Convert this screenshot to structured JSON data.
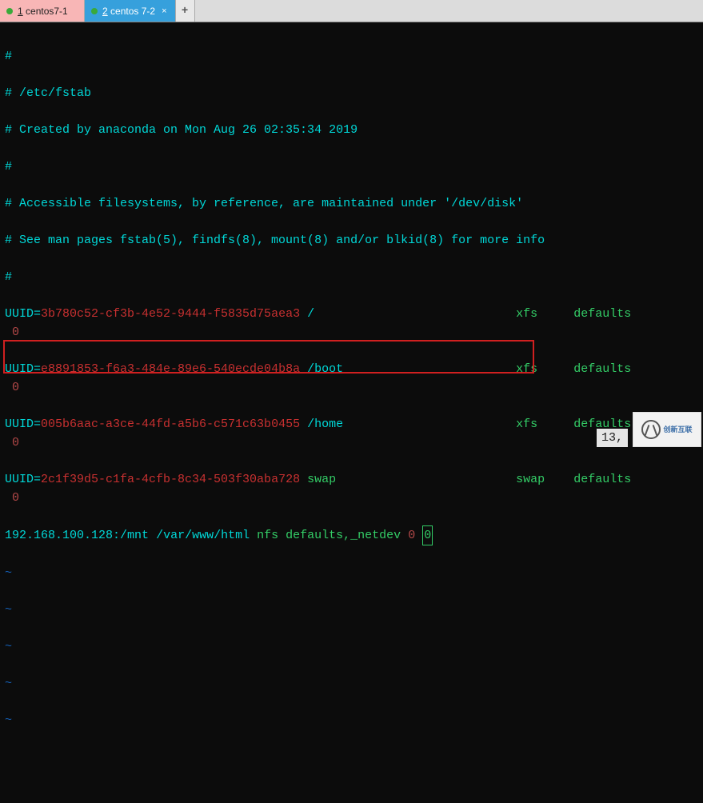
{
  "tabs": [
    {
      "num": "1",
      "label": "centos7-1",
      "active": false
    },
    {
      "num": "2",
      "label": "centos 7-2",
      "active": true
    }
  ],
  "fstab": {
    "c1": "#",
    "c2": "# /etc/fstab",
    "c3": "# Created by anaconda on Mon Aug 26 02:35:34 2019",
    "c4": "#",
    "c5": "# Accessible filesystems, by reference, are maintained under '/dev/disk'",
    "c6": "# See man pages fstab(5), findfs(8), mount(8) and/or blkid(8) for more info",
    "c7": "#",
    "entries": [
      {
        "uuid": "3b780c52-cf3b-4e52-9444-f5835d75aea3",
        "mount": "/",
        "fs": "xfs",
        "opts": "defaults",
        "dump": "0",
        "pass": "0"
      },
      {
        "uuid": "e8891853-f6a3-484e-89e6-540ecde04b8a",
        "mount": "/boot",
        "fs": "xfs",
        "opts": "defaults",
        "dump": "0",
        "pass": "0"
      },
      {
        "uuid": "005b6aac-a3ce-44fd-a5b6-c571c63b0455",
        "mount": "/home",
        "fs": "xfs",
        "opts": "defaults",
        "dump": "0",
        "pass": "0"
      },
      {
        "uuid": "2c1f39d5-c1fa-4cfb-8c34-503f30aba728",
        "mount": "swap",
        "fs": "swap",
        "opts": "defaults",
        "dump": "0",
        "pass": "0"
      }
    ],
    "nfs": {
      "ip": "192.168.100.128",
      "remote": ":/mnt",
      "local": "/var/www/html",
      "fs": "nfs",
      "opts": "defaults,_netdev",
      "dump": "0",
      "pass": "0"
    }
  },
  "tilde": "~",
  "status": "13,",
  "logo_text": "创新互联"
}
